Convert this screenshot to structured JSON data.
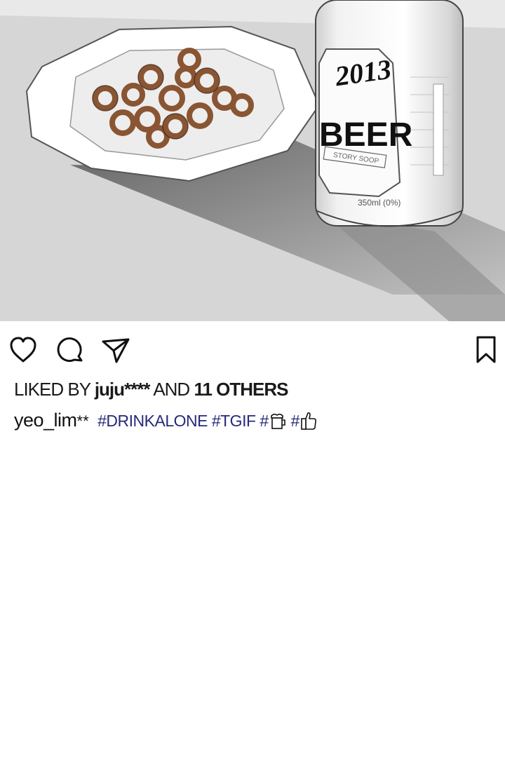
{
  "post": {
    "image": {
      "can_brand": "2013",
      "can_label": "BEER",
      "can_sublabel": "STORY SOOP",
      "can_volume": "350ml (0%)"
    },
    "actions": {
      "like_icon": "heart-icon",
      "comment_icon": "comment-icon",
      "share_icon": "send-icon",
      "save_icon": "bookmark-icon"
    },
    "likes": {
      "prefix": "LIKED BY",
      "user": "juju****",
      "middle": "AND",
      "others": "11 OTHERS"
    },
    "caption": {
      "username": "yeo_lim",
      "username_suffix": "**",
      "hashtag_1": "#DRINKALONE",
      "hashtag_2": "#TGIF",
      "hashtag_3_prefix": "#",
      "hashtag_3_icon": "beer-mug-icon",
      "hashtag_4_prefix": "#",
      "hashtag_4_icon": "thumbs-up-icon"
    },
    "colors": {
      "hashtag": "#262b7a",
      "text": "#1a1a1a"
    }
  }
}
